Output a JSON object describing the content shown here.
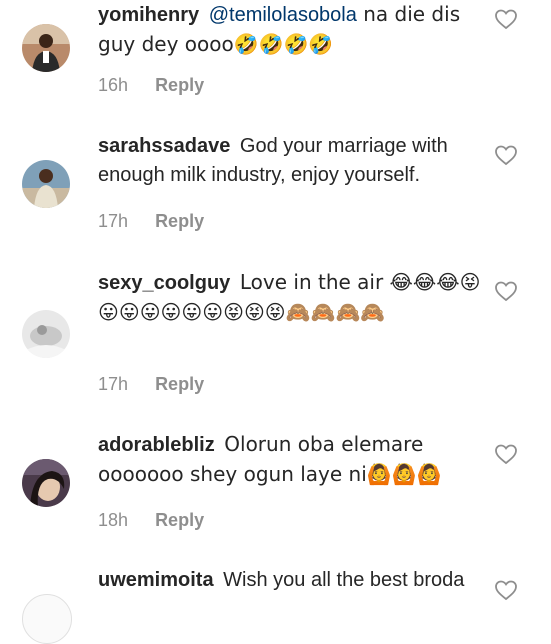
{
  "comments": [
    {
      "username": "yomihenry",
      "mention": "@temilolasobola",
      "text_after_mention": " na die dis guy dey oooo🤣🤣🤣🤣",
      "time": "16h",
      "reply_label": "Reply"
    },
    {
      "username": "sarahssadave",
      "text": "God your marriage with enough milk industry, enjoy yourself.",
      "time": "17h",
      "reply_label": "Reply"
    },
    {
      "username": "sexy_coolguy",
      "text": "Love in the air 😂😂😂😝😛😛😛😛😛😛😝😝😝🙈🙈🙈🙈",
      "time": "17h",
      "reply_label": "Reply"
    },
    {
      "username": "adorablebliz",
      "text": "Olorun oba elemare ooooooo shey ogun laye ni🙆🙆🙆",
      "time": "18h",
      "reply_label": "Reply"
    },
    {
      "username": "uwemimoita",
      "text": "Wish you all the best broda"
    }
  ],
  "icons": {
    "like": "heart-outline-icon"
  },
  "colors": {
    "text": "#262626",
    "secondary": "#8e8e8e",
    "mention": "#00376b"
  }
}
